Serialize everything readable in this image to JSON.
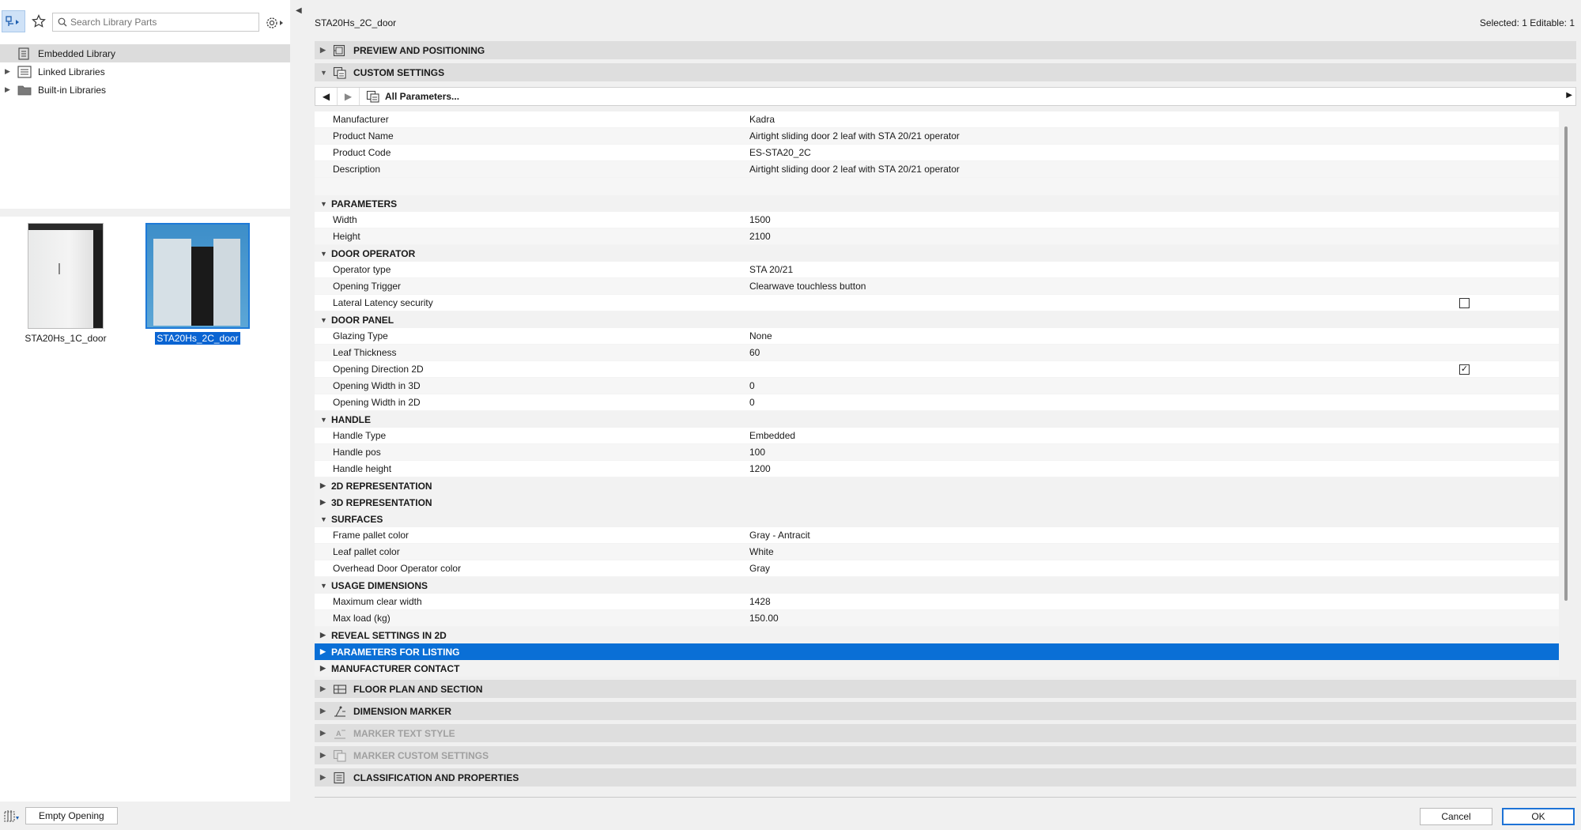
{
  "left": {
    "search": {
      "placeholder": "Search Library Parts"
    },
    "tree": [
      {
        "label": "Embedded Library",
        "selected": true,
        "expandable": false
      },
      {
        "label": "Linked Libraries",
        "selected": false,
        "expandable": true
      },
      {
        "label": "Built-in Libraries",
        "selected": false,
        "expandable": true
      }
    ],
    "thumbnails": [
      {
        "caption": "STA20Hs_1C_door",
        "selected": false
      },
      {
        "caption": "STA20Hs_2C_door",
        "selected": true
      }
    ],
    "bottom_button": "Empty Opening"
  },
  "header": {
    "title": "STA20Hs_2C_door",
    "selection_info": "Selected: 1 Editable: 1"
  },
  "sections_top": [
    {
      "label": "PREVIEW AND POSITIONING",
      "expanded": false
    },
    {
      "label": "CUSTOM SETTINGS",
      "expanded": true
    }
  ],
  "nav": {
    "dropdown_label": "All Parameters..."
  },
  "params": {
    "general": [
      {
        "name": "Manufacturer",
        "value": "Kadra"
      },
      {
        "name": "Product Name",
        "value": "Airtight sliding door 2 leaf with STA 20/21 operator"
      },
      {
        "name": "Product Code",
        "value": "ES-STA20_2C"
      },
      {
        "name": "Description",
        "value": "Airtight sliding door 2 leaf with STA 20/21 operator"
      }
    ],
    "groups": [
      {
        "label": "PARAMETERS",
        "expanded": true,
        "rows": [
          {
            "name": "Width",
            "value": "1500"
          },
          {
            "name": "Height",
            "value": "2100"
          }
        ]
      },
      {
        "label": "DOOR OPERATOR",
        "expanded": true,
        "rows": [
          {
            "name": "Operator type",
            "value": "STA 20/21"
          },
          {
            "name": "Opening Trigger",
            "value": "Clearwave touchless button"
          },
          {
            "name": "Lateral Latency security",
            "checkbox": false
          }
        ]
      },
      {
        "label": "DOOR PANEL",
        "expanded": true,
        "rows": [
          {
            "name": "Glazing Type",
            "value": "None"
          },
          {
            "name": "Leaf Thickness",
            "value": "60"
          },
          {
            "name": "Opening Direction 2D",
            "checkbox": true
          },
          {
            "name": "Opening Width in 3D",
            "value": "0"
          },
          {
            "name": "Opening Width in 2D",
            "value": "0"
          }
        ]
      },
      {
        "label": "HANDLE",
        "expanded": true,
        "rows": [
          {
            "name": "Handle Type",
            "value": "Embedded"
          },
          {
            "name": "Handle pos",
            "value": "100"
          },
          {
            "name": "Handle height",
            "value": "1200"
          }
        ]
      },
      {
        "label": "2D REPRESENTATION",
        "expanded": false,
        "rows": []
      },
      {
        "label": "3D REPRESENTATION",
        "expanded": false,
        "rows": []
      },
      {
        "label": "SURFACES",
        "expanded": true,
        "rows": [
          {
            "name": "Frame pallet color",
            "value": "Gray - Antracit"
          },
          {
            "name": "Leaf pallet color",
            "value": "White"
          },
          {
            "name": "Overhead Door Operator color",
            "value": "Gray"
          }
        ]
      },
      {
        "label": "USAGE DIMENSIONS",
        "expanded": true,
        "rows": [
          {
            "name": "Maximum clear width",
            "value": "1428"
          },
          {
            "name": "Max load (kg)",
            "value": "150.00"
          }
        ]
      },
      {
        "label": "REVEAL SETTINGS IN 2D",
        "expanded": false,
        "rows": []
      },
      {
        "label": "PARAMETERS FOR LISTING",
        "expanded": false,
        "highlighted": true,
        "rows": []
      },
      {
        "label": "MANUFACTURER CONTACT",
        "expanded": false,
        "rows": []
      }
    ]
  },
  "sections_bottom": [
    {
      "label": "FLOOR PLAN AND SECTION",
      "enabled": true,
      "icon": "floor-plan-icon"
    },
    {
      "label": "DIMENSION MARKER",
      "enabled": true,
      "icon": "dimension-marker-icon"
    },
    {
      "label": "MARKER TEXT STYLE",
      "enabled": false,
      "icon": "marker-text-icon"
    },
    {
      "label": "MARKER CUSTOM SETTINGS",
      "enabled": false,
      "icon": "marker-settings-icon"
    },
    {
      "label": "CLASSIFICATION AND PROPERTIES",
      "enabled": true,
      "icon": "classification-icon"
    }
  ],
  "footer": {
    "cancel_label": "Cancel",
    "ok_label": "OK"
  },
  "colors": {
    "highlight": "#0a6fd6",
    "selection": "#0a64d2",
    "section_bg": "#dedede"
  }
}
